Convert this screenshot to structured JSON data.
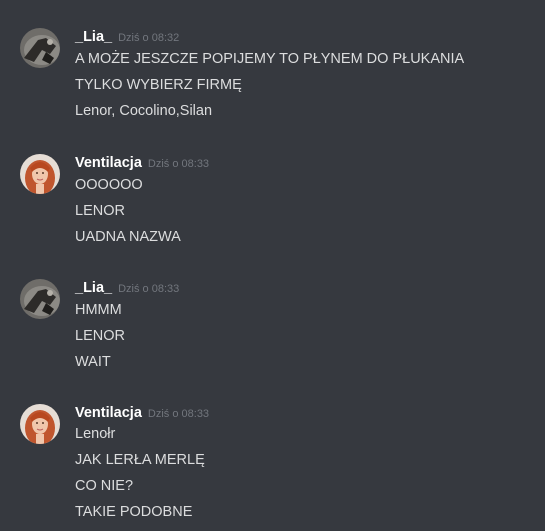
{
  "messages": [
    {
      "username": "_Lia_",
      "timestamp": "Dziś o 08:32",
      "lines": [
        "A MOŻE JESZCZE POPIJEMY TO PŁYNEM DO PŁUKANIA",
        "TYLKO WYBIERZ FIRMĘ",
        "Lenor, Cocolino,Silan"
      ]
    },
    {
      "username": "Ventilacja",
      "timestamp": "Dziś o 08:33",
      "lines": [
        "OOOOOO",
        "LENOR",
        "UADNA NAZWA"
      ]
    },
    {
      "username": "_Lia_",
      "timestamp": "Dziś o 08:33",
      "lines": [
        "HMMM",
        "LENOR",
        "WAIT"
      ]
    },
    {
      "username": "Ventilacja",
      "timestamp": "Dziś o 08:33",
      "lines": [
        "Lenołr",
        "JAK LERŁA MERLĘ",
        "CO NIE?",
        "TAKIE PODOBNE"
      ]
    }
  ],
  "colors": {
    "background": "#36393f",
    "username": "#ffffff",
    "timestamp": "#72767d",
    "message_text": "#dcddde"
  }
}
